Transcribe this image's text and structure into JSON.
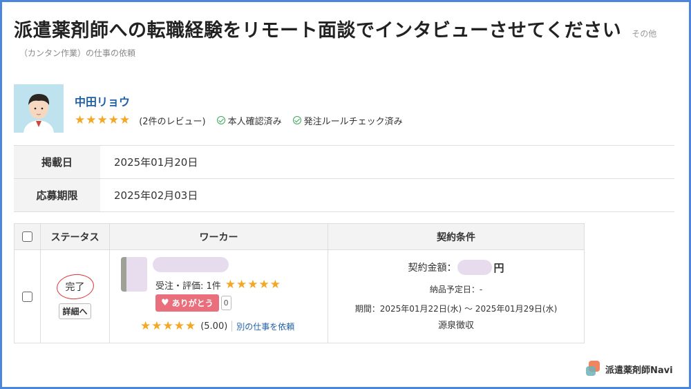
{
  "header": {
    "title": "派遣薬剤師への転職経験をリモート面談でインタビューさせてください",
    "category_other": "その他",
    "subtitle": "（カンタン作業）の仕事の依頼"
  },
  "client": {
    "name": "中田リョウ",
    "stars": "★★★★★",
    "rating": 5,
    "reviews": "(2件のレビュー)",
    "identity_verified": "本人確認済み",
    "rules_checked": "発注ルールチェック済み"
  },
  "info": {
    "posted_label": "掲載日",
    "posted_value": "2025年01月20日",
    "deadline_label": "応募期限",
    "deadline_value": "2025年02月03日"
  },
  "work_table": {
    "headers": {
      "status": "ステータス",
      "worker": "ワーカー",
      "contract": "契約条件"
    },
    "row": {
      "status": "完了",
      "detail_button": "詳細へ",
      "order_rating_label": "受注・評価: 1件",
      "order_stars": "★★★★★",
      "thanks_label": "ありがとう",
      "thanks_count": "0",
      "worker_stars": "★★★★★",
      "worker_score": "(5.00)",
      "request_other": "別の仕事を依頼",
      "contract_amount_label": "契約金額：",
      "contract_amount_unit": "円",
      "delivery": "納品予定日：-",
      "period": "期間：2025年01月22日(水) 〜 2025年01月29日(水)",
      "tax": "源泉徴収"
    }
  },
  "logo": {
    "text": "派遣薬剤師Navi"
  },
  "colors": {
    "frame": "#4a86d9",
    "link": "#1f5fa8",
    "star": "#f5a623",
    "thanks": "#ea6f7d",
    "status_circle": "#dd3333",
    "check": "#3aa757"
  }
}
